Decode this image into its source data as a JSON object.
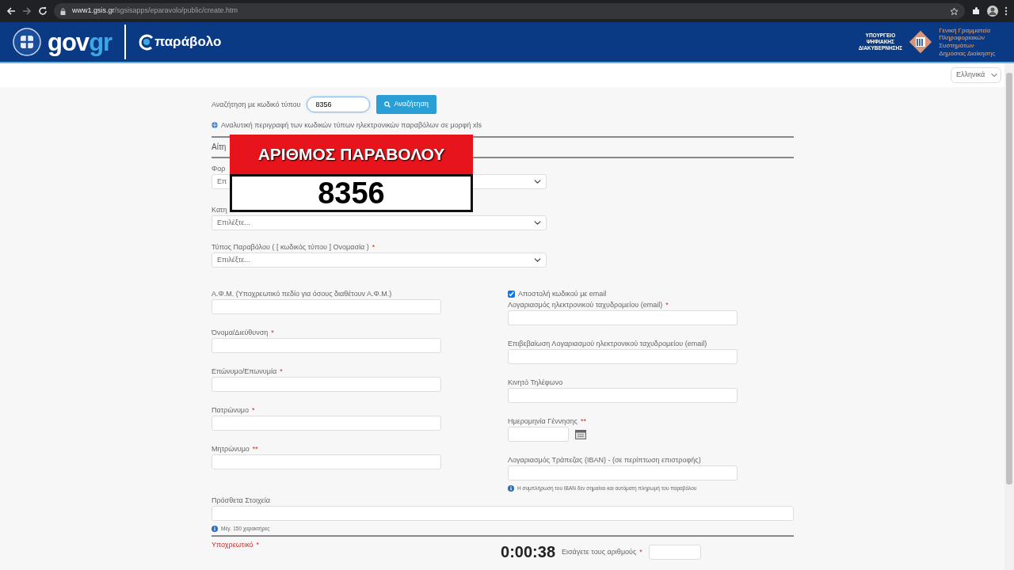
{
  "browser": {
    "url_host": "www1.gsis.gr",
    "url_path": "/sgsisapps/eparavolo/public/create.htm"
  },
  "header": {
    "brand": "gov",
    "brand_accent": "gr",
    "app_name": "παράβολο",
    "ministry": [
      "ΥΠΟΥΡΓΕΙΟ",
      "ΨΗΦΙΑΚΗΣ",
      "ΔΙΑΚΥΒΕΡΝΗΣΗΣ"
    ],
    "secretariat": [
      "Γενική Γραμματεία",
      "Πληροφοριακών",
      "Συστημάτων",
      "Δημόσιας Διοίκησης"
    ]
  },
  "language": {
    "value": "Ελληνικά"
  },
  "search": {
    "label": "Αναζήτηση με κωδικό τύπου",
    "value": "8356",
    "button": "Αναζήτηση"
  },
  "info_link": "Αναλυτική περιγραφή των κωδικών τύπων ηλεκτρονικών παραβόλων σε μορφή xls",
  "section_title": "Αίτη",
  "selects": [
    {
      "label": "Φορ",
      "placeholder": "Επ"
    },
    {
      "label": "Κατη",
      "placeholder": "Επιλέξτε..."
    },
    {
      "label": "Τύπος Παραβόλου ( [ κωδικός τύπου ] Ονομασία )",
      "marker": "*",
      "placeholder": "Επιλέξτε..."
    }
  ],
  "left_fields": [
    {
      "label": "Α.Φ.Μ. (Υποχρεωτικό πεδίο για όσους διαθέτουν Α.Φ.Μ.)"
    },
    {
      "label": "Όνομα/Διεύθυνση",
      "marker": "*"
    },
    {
      "label": "Επώνυμο/Επωνυμία",
      "marker": "*"
    },
    {
      "label": "Πατρώνυμο",
      "marker": "*"
    },
    {
      "label": "Μητρώνυμο",
      "marker": "**"
    }
  ],
  "email_option": {
    "label": "Αποστολή κωδικού με email",
    "checked": true
  },
  "right_fields": [
    {
      "kind": "text",
      "label": "Λογαριασμός ηλεκτρονικού ταχυδρομείου (email)",
      "marker": "*"
    },
    {
      "kind": "text",
      "label": "Επιβεβαίωση Λογαριασμού ηλεκτρονικού ταχυδρομείου (email)"
    },
    {
      "kind": "text",
      "label": "Κινητό Τηλέφωνο"
    },
    {
      "kind": "date",
      "label": "Ημερομηνία Γέννησης",
      "marker": "**"
    },
    {
      "kind": "text",
      "label": "Λογαριασμός Τράπεζας (IBAN) - (σε περίπτωση επιστροφής)",
      "note": "Η συμπλήρωση του IBAN δεν σημαίνει και αυτόματη πληρωμή του παραβόλου"
    }
  ],
  "extra": {
    "label": "Πρόσθετα Στοιχεία",
    "note": "Μέγ. 150 χαρακτήρες"
  },
  "required_note": {
    "label": "Υποχρεωτικό",
    "marker": "*"
  },
  "captcha": {
    "code": "0:00:38",
    "label": "Εισάγετε τους αριθμούς",
    "marker": "*"
  },
  "overlay": {
    "title": "ΑΡΙΘΜΟΣ ΠΑΡΑΒΟΛΟΥ",
    "number": "8356"
  }
}
